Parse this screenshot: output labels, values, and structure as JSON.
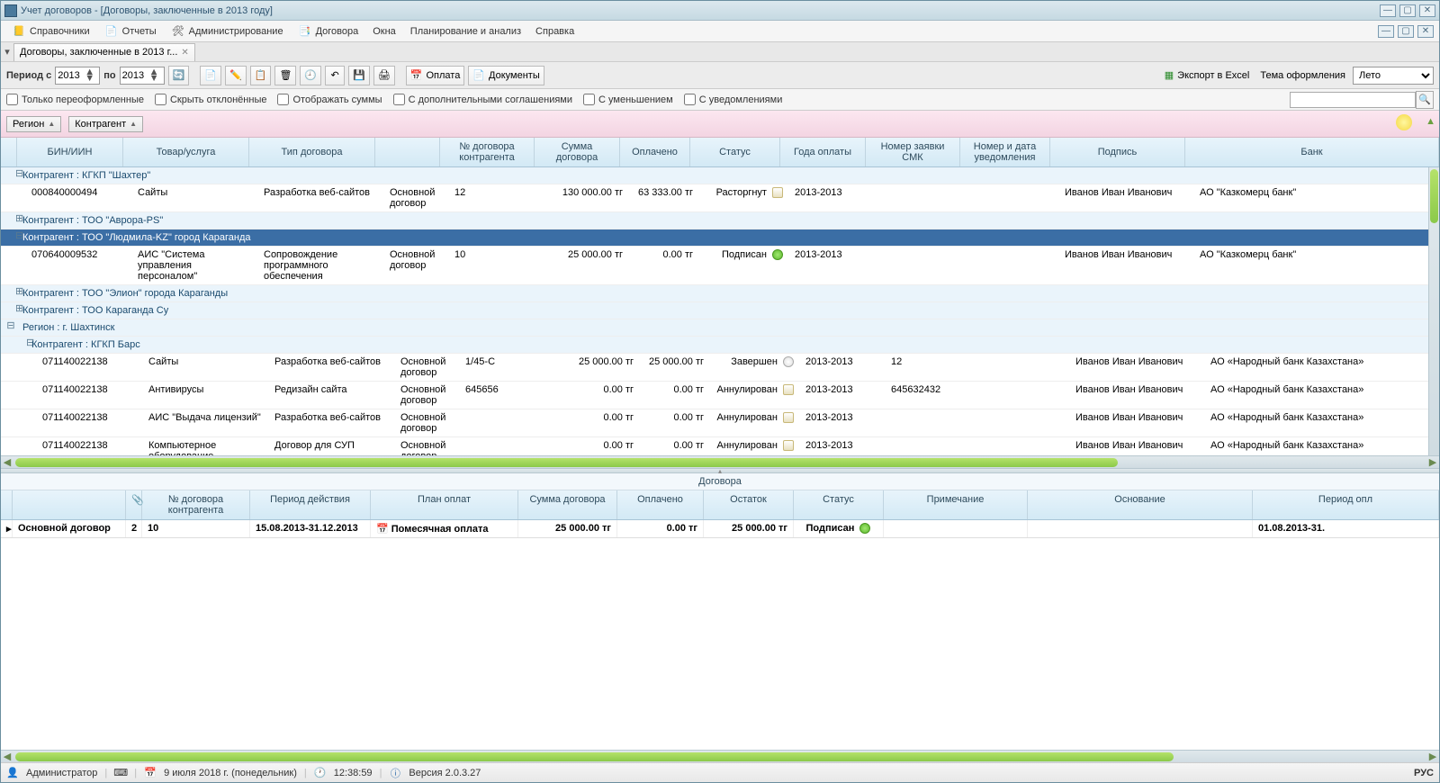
{
  "title": "Учет договоров - [Договоры, заключенные в 2013 году]",
  "menus": {
    "spravochniki": "Справочники",
    "otchety": "Отчеты",
    "admin": "Администрирование",
    "dogovora": "Договора",
    "okna": "Окна",
    "plan": "Планирование и анализ",
    "spravka": "Справка"
  },
  "tab": {
    "label": "Договоры, заключенные в 2013 г..."
  },
  "toolbar": {
    "period_s": "Период с",
    "year_from": "2013",
    "po": "по",
    "year_to": "2013",
    "oplata": "Оплата",
    "documents": "Документы",
    "export": "Экспорт в Excel",
    "theme_label": "Тема оформления",
    "theme_value": "Лето"
  },
  "filters": {
    "only_re": "Только переоформленные",
    "hide_decl": "Скрыть отклонённые",
    "show_sum": "Отображать суммы",
    "with_add": "С дополнительными соглашениями",
    "with_decr": "С уменьшением",
    "with_notif": "С уведомлениями"
  },
  "group_chips": {
    "region": "Регион",
    "counterparty": "Контрагент"
  },
  "columns": {
    "bin": "БИН/ИИН",
    "product": "Товар/услуга",
    "contract_type": "Тип договора",
    "blank": "",
    "contract_no": "№ договора контрагента",
    "sum": "Сумма договора",
    "paid": "Оплачено",
    "status": "Статус",
    "pay_years": "Года оплаты",
    "smk_no": "Номер заявки СМК",
    "notif": "Номер и дата уведомления",
    "sign": "Подпись",
    "bank": "Банк"
  },
  "groups": [
    {
      "type": "counterparty",
      "label": "Контрагент : КГКП \"Шахтер\"",
      "expanded": true,
      "rows": [
        {
          "bin": "000840000494",
          "product": "Сайты",
          "contract_type": "Разработка веб-сайтов",
          "doc": "Основной договор",
          "no": "12",
          "sum": "130 000.00 тг",
          "paid": "63 333.00 тг",
          "status": "Расторгнут",
          "status_icon": "doc",
          "years": "2013-2013",
          "smk": "",
          "notif": "",
          "sign": "Иванов Иван Иванович",
          "bank": "АО \"Казкомерц банк\""
        }
      ]
    },
    {
      "type": "counterparty",
      "label": "Контрагент : ТОО \"Аврора-PS\"",
      "expanded": false,
      "rows": []
    },
    {
      "type": "counterparty",
      "label": "Контрагент : ТОО \"Людмила-KZ\" город Караганда",
      "expanded": true,
      "selected": true,
      "rows": [
        {
          "bin": "070640009532",
          "product": "АИС \"Система управления персоналом\"",
          "contract_type": "Сопровождение программного обеспечения",
          "doc": "Основной договор",
          "no": "10",
          "sum": "25 000.00 тг",
          "paid": "0.00 тг",
          "status": "Подписан",
          "status_icon": "ok",
          "years": "2013-2013",
          "smk": "",
          "notif": "",
          "sign": "Иванов Иван Иванович",
          "bank": "АО \"Казкомерц банк\""
        }
      ]
    },
    {
      "type": "counterparty",
      "label": "Контрагент : ТОО \"Элион\" города Караганды",
      "expanded": false,
      "rows": []
    },
    {
      "type": "counterparty",
      "label": "Контрагент : ТОО Караганда Су",
      "expanded": false,
      "rows": []
    },
    {
      "type": "region",
      "label": "Регион : г. Шахтинск",
      "expanded": true,
      "rows": []
    },
    {
      "type": "counterparty",
      "label": "Контрагент : КГКП Барс",
      "indent": 1,
      "expanded": true,
      "rows": [
        {
          "bin": "071140022138",
          "product": "Сайты",
          "contract_type": "Разработка веб-сайтов",
          "doc": "Основной договор",
          "no": "1/45-С",
          "sum": "25 000.00 тг",
          "paid": "25 000.00 тг",
          "status": "Завершен",
          "status_icon": "warn",
          "years": "2013-2013",
          "smk": "12",
          "notif": "",
          "sign": "Иванов Иван Иванович",
          "bank": "АО «Народный банк Казахстана»"
        },
        {
          "bin": "071140022138",
          "product": "Антивирусы",
          "contract_type": "Редизайн сайта",
          "doc": "Основной договор",
          "no": "645656",
          "sum": "0.00 тг",
          "paid": "0.00 тг",
          "status": "Аннулирован",
          "status_icon": "doc",
          "years": "2013-2013",
          "smk": "645632432",
          "notif": "",
          "sign": "Иванов Иван Иванович",
          "bank": "АО «Народный банк Казахстана»"
        },
        {
          "bin": "071140022138",
          "product": "АИС \"Выдача лицензий\"",
          "contract_type": "Разработка веб-сайтов",
          "doc": "Основной договор",
          "no": "",
          "sum": "0.00 тг",
          "paid": "0.00 тг",
          "status": "Аннулирован",
          "status_icon": "doc",
          "years": "2013-2013",
          "smk": "",
          "notif": "",
          "sign": "Иванов Иван Иванович",
          "bank": "АО «Народный банк Казахстана»"
        },
        {
          "bin": "071140022138",
          "product": "Компьютерное оборудование",
          "contract_type": "Договор для СУП",
          "doc": "Основной договор",
          "no": "",
          "sum": "0.00 тг",
          "paid": "0.00 тг",
          "status": "Аннулирован",
          "status_icon": "doc",
          "years": "2013-2013",
          "smk": "",
          "notif": "",
          "sign": "Иванов Иван Иванович",
          "bank": "АО «Народный банк Казахстана»"
        }
      ]
    }
  ],
  "bottom": {
    "title": "Договора",
    "cols": {
      "name": "",
      "atc": "",
      "no": "№ договора контрагента",
      "period": "Период действия",
      "plan": "План оплат",
      "sum": "Сумма договора",
      "paid": "Оплачено",
      "ost": "Остаток",
      "status": "Статус",
      "note": "Примечание",
      "basis": "Основание",
      "pay_period": "Период опл"
    },
    "row": {
      "name": "Основной договор",
      "atc": "2",
      "no": "10",
      "period": "15.08.2013-31.12.2013",
      "plan": "Помесячная оплата",
      "sum": "25 000.00 тг",
      "paid": "0.00 тг",
      "ost": "25 000.00 тг",
      "status": "Подписан",
      "note": "",
      "basis": "",
      "pay_period": "01.08.2013-31."
    }
  },
  "status": {
    "user": "Администратор",
    "date": "9 июля 2018 г. (понедельник)",
    "time": "12:38:59",
    "version": "Версия 2.0.3.27",
    "lang": "РУС"
  }
}
